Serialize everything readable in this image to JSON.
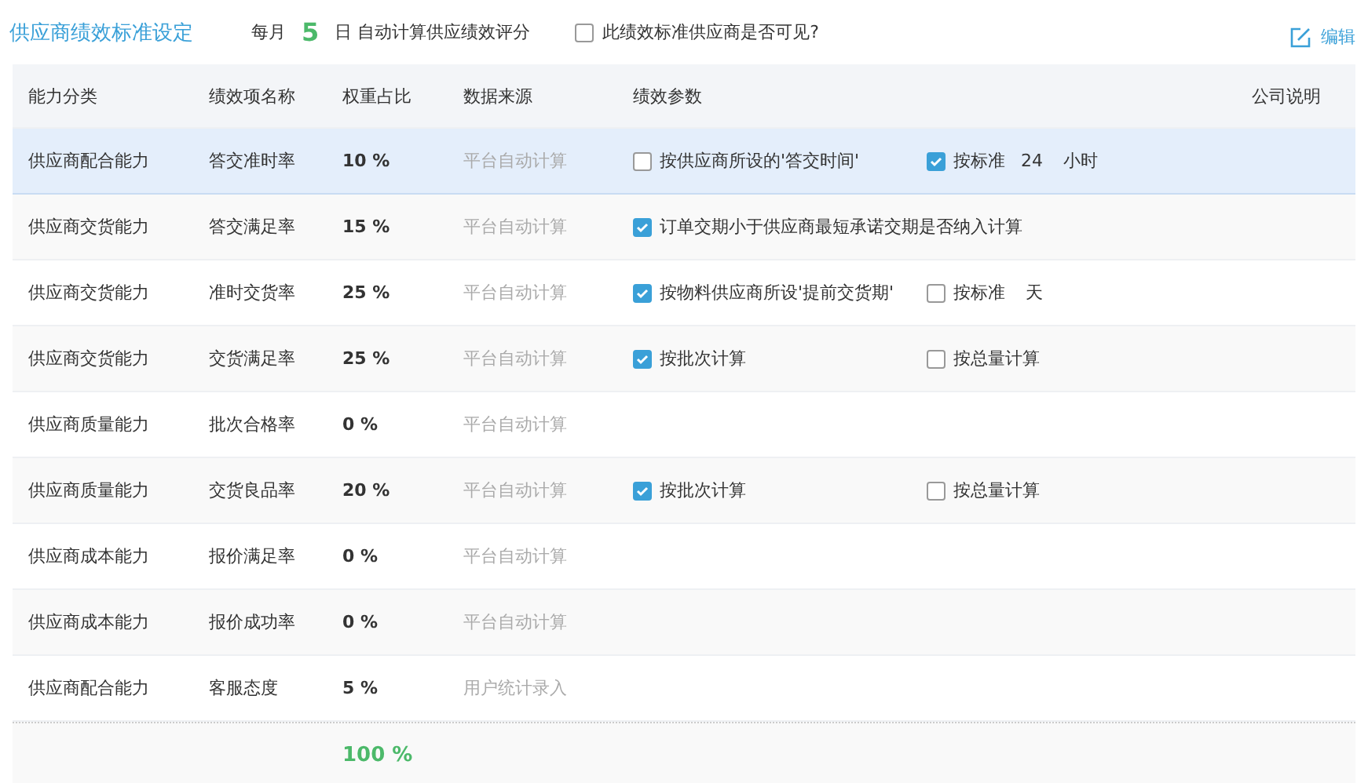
{
  "header": {
    "title": "供应商绩效标准设定",
    "schedule_prefix": "每月",
    "schedule_day": "5",
    "schedule_suffix": "日 自动计算供应绩效评分",
    "visibility": {
      "label": "此绩效标准供应商是否可见?",
      "checked": false
    },
    "edit": "编辑"
  },
  "table": {
    "columns": [
      "能力分类",
      "绩效项名称",
      "权重占比",
      "数据来源",
      "绩效参数",
      "公司说明"
    ],
    "rows": [
      {
        "category": "供应商配合能力",
        "name": "答交准时率",
        "weight": "10 %",
        "source": "平台自动计算",
        "selected": true,
        "params": [
          {
            "label": "按供应商所设的'答交时间'",
            "checked": false
          },
          {
            "label": "按标准",
            "checked": true,
            "value": "24",
            "unit": "小时"
          }
        ]
      },
      {
        "category": "供应商交货能力",
        "name": "答交满足率",
        "weight": "15 %",
        "source": "平台自动计算",
        "selected": false,
        "params": [
          {
            "label": "订单交期小于供应商最短承诺交期是否纳入计算",
            "checked": true
          }
        ]
      },
      {
        "category": "供应商交货能力",
        "name": "准时交货率",
        "weight": "25 %",
        "source": "平台自动计算",
        "selected": false,
        "params": [
          {
            "label": "按物料供应商所设'提前交货期'",
            "checked": true
          },
          {
            "label": "按标准",
            "checked": false,
            "unit": "天"
          }
        ]
      },
      {
        "category": "供应商交货能力",
        "name": "交货满足率",
        "weight": "25 %",
        "source": "平台自动计算",
        "selected": false,
        "params": [
          {
            "label": "按批次计算",
            "checked": true
          },
          {
            "label": "按总量计算",
            "checked": false
          }
        ]
      },
      {
        "category": "供应商质量能力",
        "name": "批次合格率",
        "weight": "0 %",
        "source": "平台自动计算",
        "selected": false
      },
      {
        "category": "供应商质量能力",
        "name": "交货良品率",
        "weight": "20 %",
        "source": "平台自动计算",
        "selected": false,
        "params": [
          {
            "label": "按批次计算",
            "checked": true
          },
          {
            "label": "按总量计算",
            "checked": false
          }
        ]
      },
      {
        "category": "供应商成本能力",
        "name": "报价满足率",
        "weight": "0 %",
        "source": "平台自动计算",
        "selected": false
      },
      {
        "category": "供应商成本能力",
        "name": "报价成功率",
        "weight": "0 %",
        "source": "平台自动计算",
        "selected": false
      },
      {
        "category": "供应商配合能力",
        "name": "客服态度",
        "weight": "5 %",
        "source": "用户统计录入",
        "selected": false
      }
    ],
    "total": "100 %"
  }
}
